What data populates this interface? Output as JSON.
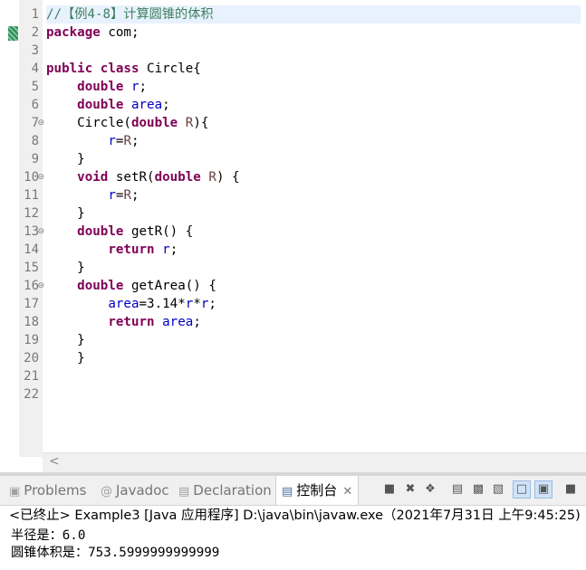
{
  "editor": {
    "lines": [
      {
        "n": "1",
        "tokens": [
          {
            "c": "cmt",
            "t": "//【例4-8】计算圆锥的体积"
          }
        ]
      },
      {
        "n": "2",
        "tokens": [
          {
            "c": "kw",
            "t": "package"
          },
          {
            "c": "",
            "t": " com;"
          }
        ]
      },
      {
        "n": "3",
        "tokens": []
      },
      {
        "n": "4",
        "tokens": [
          {
            "c": "kw",
            "t": "public"
          },
          {
            "c": "",
            "t": " "
          },
          {
            "c": "kw",
            "t": "class"
          },
          {
            "c": "",
            "t": " Circle{"
          }
        ]
      },
      {
        "n": "5",
        "tokens": [
          {
            "c": "",
            "t": "    "
          },
          {
            "c": "kw",
            "t": "double"
          },
          {
            "c": "",
            "t": " "
          },
          {
            "c": "fld",
            "t": "r"
          },
          {
            "c": "",
            "t": ";"
          }
        ]
      },
      {
        "n": "6",
        "tokens": [
          {
            "c": "",
            "t": "    "
          },
          {
            "c": "kw",
            "t": "double"
          },
          {
            "c": "",
            "t": " "
          },
          {
            "c": "fld",
            "t": "area"
          },
          {
            "c": "",
            "t": ";"
          }
        ]
      },
      {
        "n": "7",
        "fold": true,
        "tokens": [
          {
            "c": "",
            "t": "    Circle("
          },
          {
            "c": "kw",
            "t": "double"
          },
          {
            "c": "",
            "t": " "
          },
          {
            "c": "prm",
            "t": "R"
          },
          {
            "c": "",
            "t": "){"
          }
        ]
      },
      {
        "n": "8",
        "tokens": [
          {
            "c": "",
            "t": "        "
          },
          {
            "c": "fld",
            "t": "r"
          },
          {
            "c": "",
            "t": "="
          },
          {
            "c": "prm",
            "t": "R"
          },
          {
            "c": "",
            "t": ";"
          }
        ]
      },
      {
        "n": "9",
        "tokens": [
          {
            "c": "",
            "t": "    }"
          }
        ]
      },
      {
        "n": "10",
        "fold": true,
        "tokens": [
          {
            "c": "",
            "t": "    "
          },
          {
            "c": "kw",
            "t": "void"
          },
          {
            "c": "",
            "t": " setR("
          },
          {
            "c": "kw",
            "t": "double"
          },
          {
            "c": "",
            "t": " "
          },
          {
            "c": "prm",
            "t": "R"
          },
          {
            "c": "",
            "t": ") {"
          }
        ]
      },
      {
        "n": "11",
        "tokens": [
          {
            "c": "",
            "t": "        "
          },
          {
            "c": "fld",
            "t": "r"
          },
          {
            "c": "",
            "t": "="
          },
          {
            "c": "prm",
            "t": "R"
          },
          {
            "c": "",
            "t": ";"
          }
        ]
      },
      {
        "n": "12",
        "tokens": [
          {
            "c": "",
            "t": "    }"
          }
        ]
      },
      {
        "n": "13",
        "fold": true,
        "tokens": [
          {
            "c": "",
            "t": "    "
          },
          {
            "c": "kw",
            "t": "double"
          },
          {
            "c": "",
            "t": " getR() {"
          }
        ]
      },
      {
        "n": "14",
        "tokens": [
          {
            "c": "",
            "t": "        "
          },
          {
            "c": "kw",
            "t": "return"
          },
          {
            "c": "",
            "t": " "
          },
          {
            "c": "fld",
            "t": "r"
          },
          {
            "c": "",
            "t": ";"
          }
        ]
      },
      {
        "n": "15",
        "tokens": [
          {
            "c": "",
            "t": "    }"
          }
        ]
      },
      {
        "n": "16",
        "fold": true,
        "tokens": [
          {
            "c": "",
            "t": "    "
          },
          {
            "c": "kw",
            "t": "double"
          },
          {
            "c": "",
            "t": " getArea() {"
          }
        ]
      },
      {
        "n": "17",
        "tokens": [
          {
            "c": "",
            "t": "        "
          },
          {
            "c": "fld",
            "t": "area"
          },
          {
            "c": "",
            "t": "=3.14*"
          },
          {
            "c": "fld",
            "t": "r"
          },
          {
            "c": "",
            "t": "*"
          },
          {
            "c": "fld",
            "t": "r"
          },
          {
            "c": "",
            "t": ";"
          }
        ]
      },
      {
        "n": "18",
        "tokens": [
          {
            "c": "",
            "t": "        "
          },
          {
            "c": "kw",
            "t": "return"
          },
          {
            "c": "",
            "t": " "
          },
          {
            "c": "fld",
            "t": "area"
          },
          {
            "c": "",
            "t": ";"
          }
        ]
      },
      {
        "n": "19",
        "tokens": [
          {
            "c": "",
            "t": "    }"
          }
        ]
      },
      {
        "n": "20",
        "tokens": [
          {
            "c": "",
            "t": "    }"
          }
        ]
      },
      {
        "n": "21",
        "tokens": []
      },
      {
        "n": "22",
        "tokens": []
      }
    ],
    "highlighted_line": "1",
    "scroll_left_icon": "chevron-left-icon"
  },
  "tabs": [
    {
      "label": "Problems",
      "icon": "problems-icon"
    },
    {
      "label": "Javadoc",
      "icon": "at-icon"
    },
    {
      "label": "Declaration",
      "icon": "declaration-icon"
    },
    {
      "label": "控制台",
      "icon": "console-icon"
    }
  ],
  "toolbar": [
    {
      "name": "stop-icon"
    },
    {
      "name": "remove-launch-icon"
    },
    {
      "name": "remove-all-terminated-icon"
    },
    {
      "name": "scroll-lock-icon"
    },
    {
      "name": "show-console-output-icon"
    },
    {
      "name": "word-wrap-icon"
    },
    {
      "name": "pin-console-icon"
    },
    {
      "name": "display-selected-console-icon"
    },
    {
      "name": "open-console-icon"
    }
  ],
  "console": {
    "header": "<已终止> Example3 [Java 应用程序] D:\\java\\bin\\javaw.exe（2021年7月31日 上午9:45:25)",
    "output": [
      "半径是：6.0",
      "圆锥体积是：753.5999999999999"
    ]
  },
  "colors": {
    "keyword": "#7f0055",
    "field": "#0000c0",
    "parameter": "#6a3e3e",
    "comment": "#3f7f5f",
    "current_line": "#e8f2fe"
  }
}
